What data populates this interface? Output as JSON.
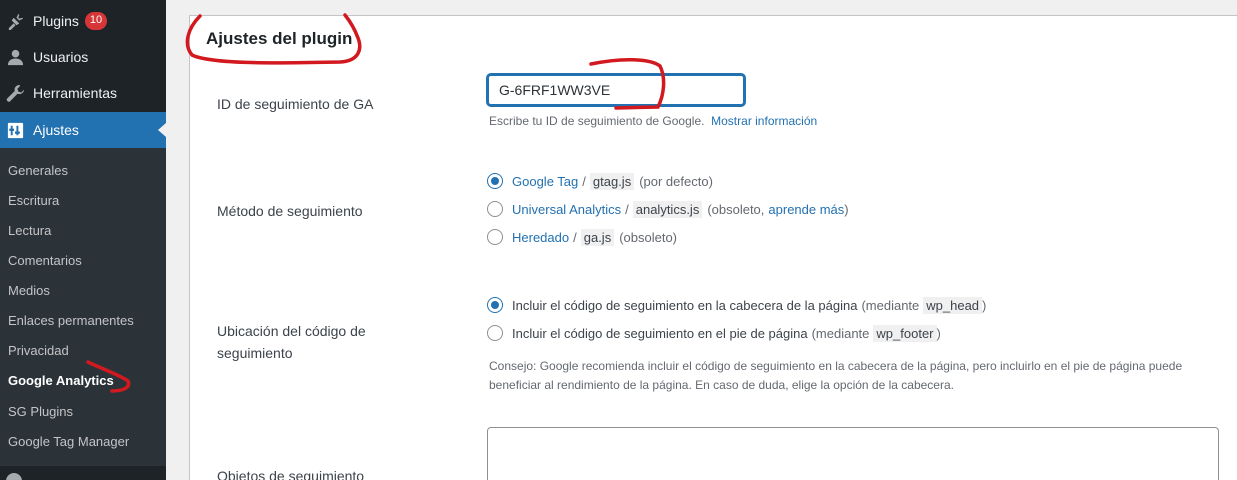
{
  "sidebar": {
    "menu": [
      {
        "label": "Plugins",
        "icon": "plug-icon",
        "badge": "10"
      },
      {
        "label": "Usuarios",
        "icon": "user-icon"
      },
      {
        "label": "Herramientas",
        "icon": "wrench-icon"
      },
      {
        "label": "Ajustes",
        "icon": "settings-icon",
        "active": true
      }
    ],
    "submenu": [
      {
        "label": "Generales"
      },
      {
        "label": "Escritura"
      },
      {
        "label": "Lectura"
      },
      {
        "label": "Comentarios"
      },
      {
        "label": "Medios"
      },
      {
        "label": "Enlaces permanentes"
      },
      {
        "label": "Privacidad"
      },
      {
        "label": "Google Analytics",
        "current": true
      },
      {
        "label": "SG Plugins"
      },
      {
        "label": "Google Tag Manager"
      }
    ]
  },
  "settings": {
    "title": "Ajustes del plugin",
    "ga_id": {
      "label": "ID de seguimiento de GA",
      "value": "G-6FRF1WW3VE",
      "help": "Escribe tu ID de seguimiento de Google.",
      "help_link": "Mostrar información"
    },
    "method": {
      "label": "Método de seguimiento",
      "options": [
        {
          "name": "Google Tag",
          "code": "gtag.js",
          "note": "(por defecto)",
          "checked": true
        },
        {
          "name": "Universal Analytics",
          "code": "analytics.js",
          "note_prefix": "(obsoleto,",
          "note_link": "aprende más",
          "note_suffix": ")",
          "checked": false
        },
        {
          "name": "Heredado",
          "code": "ga.js",
          "note": "(obsoleto)",
          "checked": false
        }
      ]
    },
    "location": {
      "label": "Ubicación del código de seguimiento",
      "options": [
        {
          "text": "Incluir el código de seguimiento en la cabecera de la página",
          "note": "(mediante",
          "code": "wp_head",
          "close": ")",
          "checked": true
        },
        {
          "text": "Incluir el código de seguimiento en el pie de página",
          "note": "(mediante",
          "code": "wp_footer",
          "close": ")",
          "checked": false
        }
      ],
      "tip_line1": "Consejo: Google recomienda incluir el código de seguimiento en la cabecera de la página, pero incluirlo en el pie de página puede",
      "tip_line2": "beneficiar al rendimiento de la página. En caso de duda, elige la opción de la cabecera."
    },
    "objects": {
      "label": "Objetos de seguimiento"
    }
  },
  "colors": {
    "accent": "#2271b1",
    "sidebar_bg": "#1d2327",
    "annotation": "#d2191f"
  }
}
